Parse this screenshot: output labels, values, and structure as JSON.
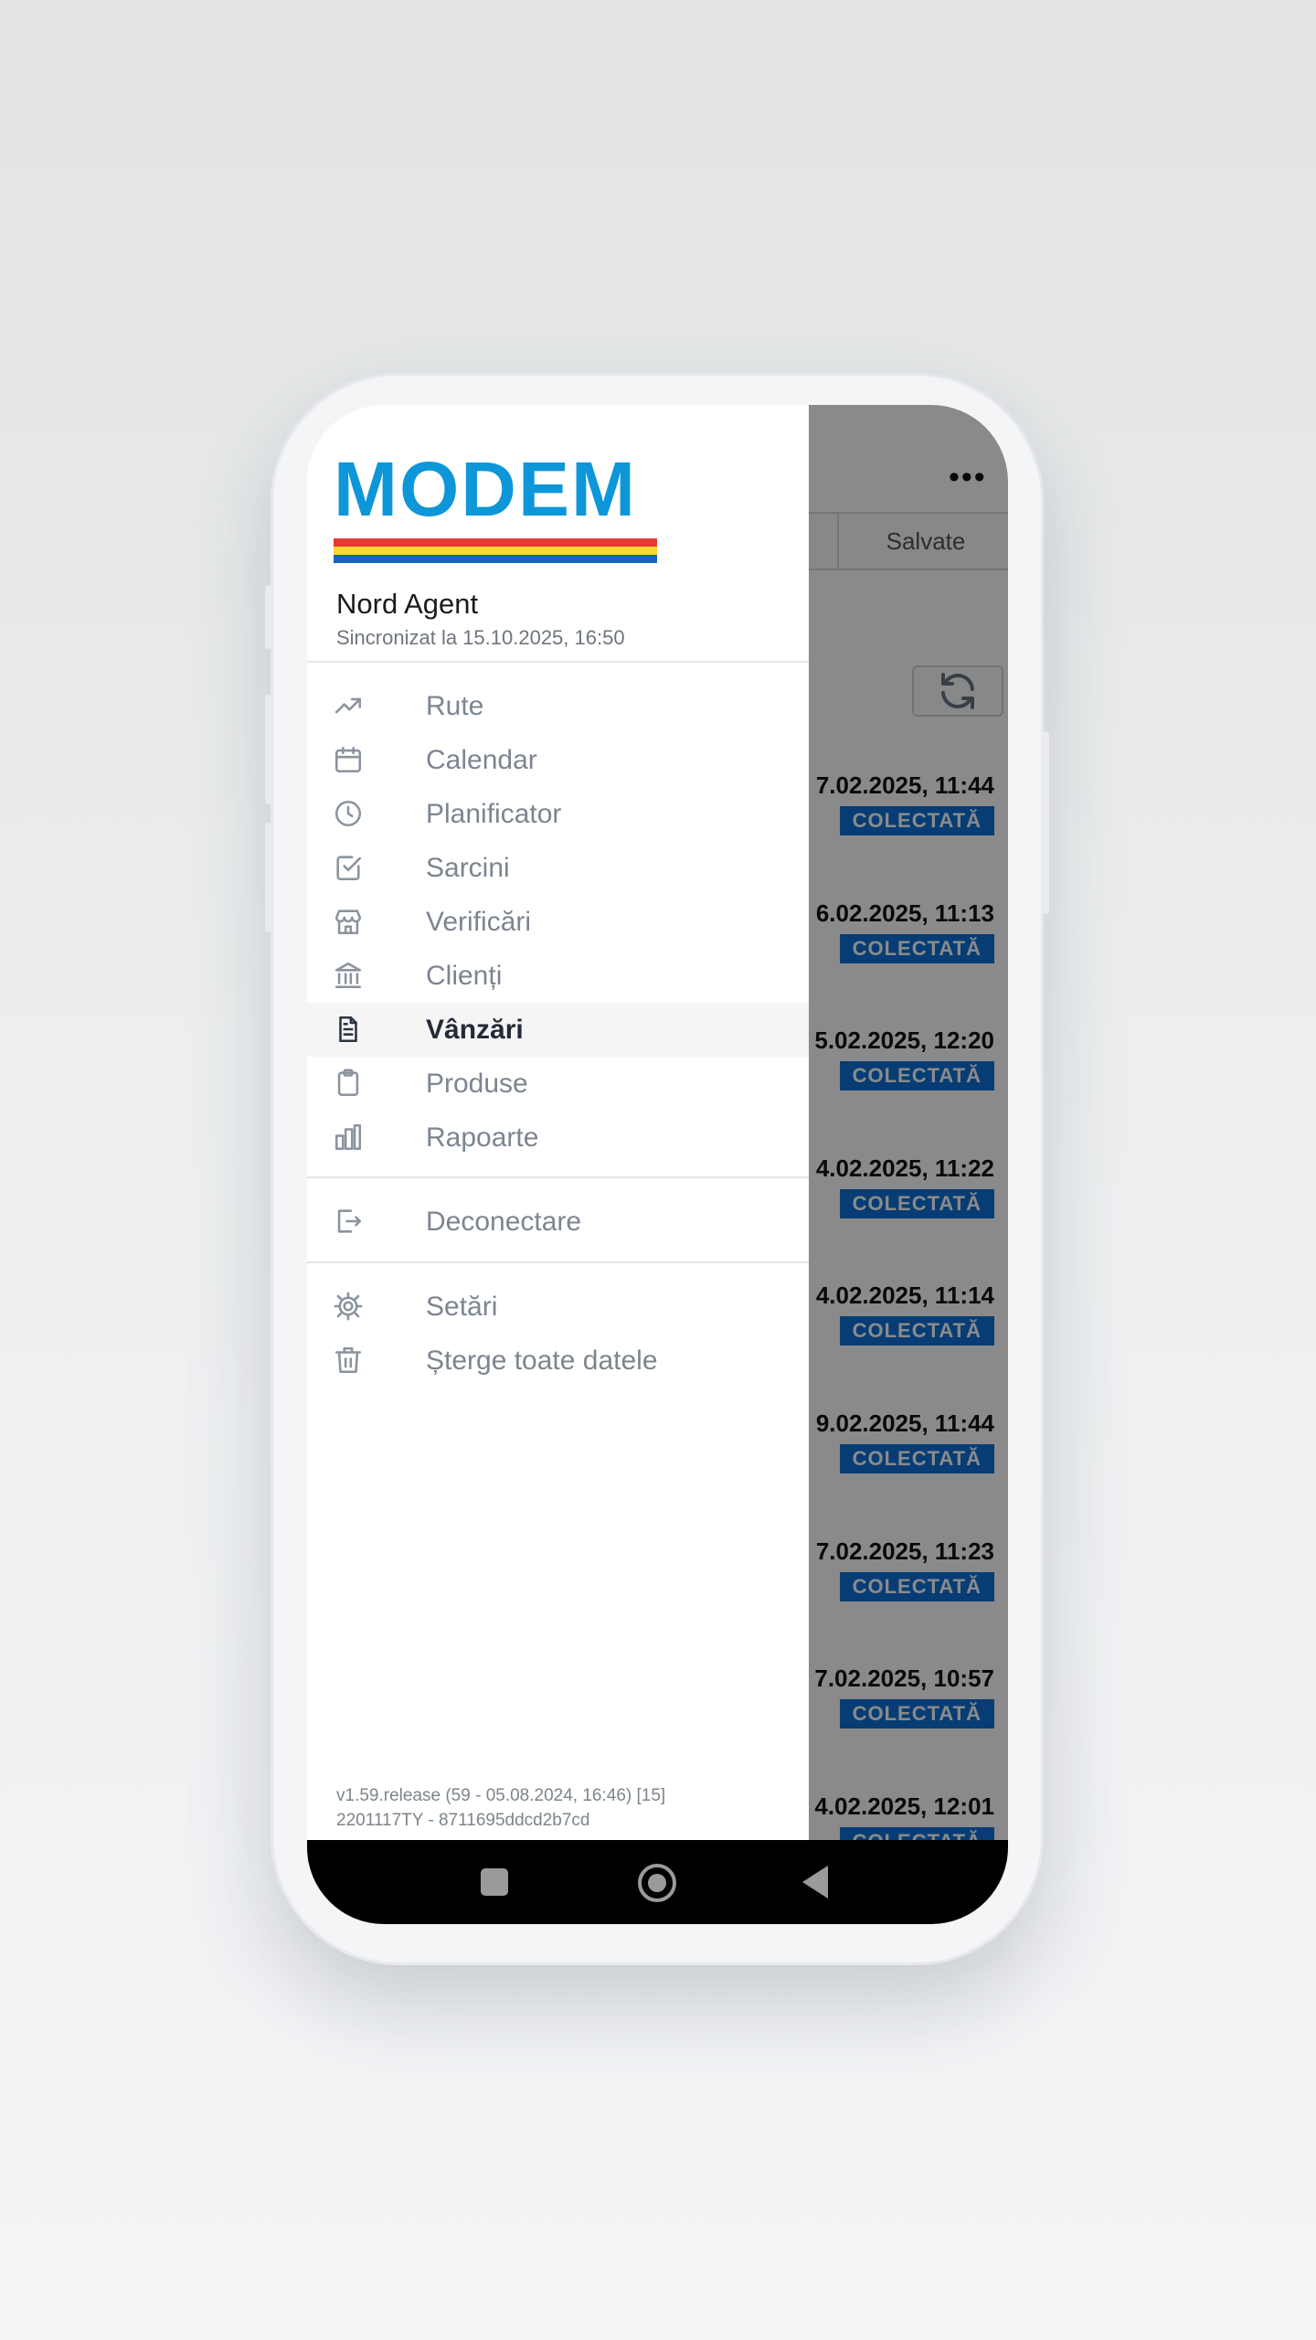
{
  "background_app": {
    "tabs": [
      "",
      "Salvate"
    ],
    "orders": [
      {
        "date": "7.02.2025, 11:44",
        "status": "COLECTATĂ"
      },
      {
        "date": "6.02.2025, 11:13",
        "status": "COLECTATĂ"
      },
      {
        "date": "5.02.2025, 12:20",
        "status": "COLECTATĂ"
      },
      {
        "date": "4.02.2025, 11:22",
        "status": "COLECTATĂ"
      },
      {
        "date": "4.02.2025, 11:14",
        "status": "COLECTATĂ"
      },
      {
        "date": "9.02.2025, 11:44",
        "status": "COLECTATĂ"
      },
      {
        "date": "7.02.2025, 11:23",
        "status": "COLECTATĂ"
      },
      {
        "date": "7.02.2025, 10:57",
        "status": "COLECTATĂ"
      },
      {
        "date": "4.02.2025, 12:01",
        "status": "COLECTATĂ"
      }
    ]
  },
  "drawer": {
    "logo_text": "MODEM",
    "user_name": "Nord Agent",
    "sync_text": "Sincronizat la 15.10.2025, 16:50",
    "menu": [
      {
        "label": "Rute",
        "icon": "trending-up-icon"
      },
      {
        "label": "Calendar",
        "icon": "calendar-icon"
      },
      {
        "label": "Planificator",
        "icon": "clock-icon"
      },
      {
        "label": "Sarcini",
        "icon": "checkbox-icon"
      },
      {
        "label": "Verificări",
        "icon": "store-icon"
      },
      {
        "label": "Clienți",
        "icon": "bank-icon"
      },
      {
        "label": "Vânzări",
        "icon": "document-icon",
        "active": true
      },
      {
        "label": "Produse",
        "icon": "clipboard-icon"
      },
      {
        "label": "Rapoarte",
        "icon": "bar-chart-icon"
      }
    ],
    "logout": {
      "label": "Deconectare",
      "icon": "logout-icon"
    },
    "settings": [
      {
        "label": "Setări",
        "icon": "gear-icon"
      },
      {
        "label": "Șterge toate datele",
        "icon": "trash-icon"
      }
    ],
    "version_line1": "v1.59.release (59 - 05.08.2024, 16:46) [15]",
    "version_line2": "2201117TY - 8711695ddcd2b7cd"
  },
  "colors": {
    "logo_blue": "#0d96d8",
    "flag_red": "#e53935",
    "flag_yellow": "#fdd835",
    "flag_blue": "#1565c0",
    "badge_blue": "#0d72d6"
  }
}
